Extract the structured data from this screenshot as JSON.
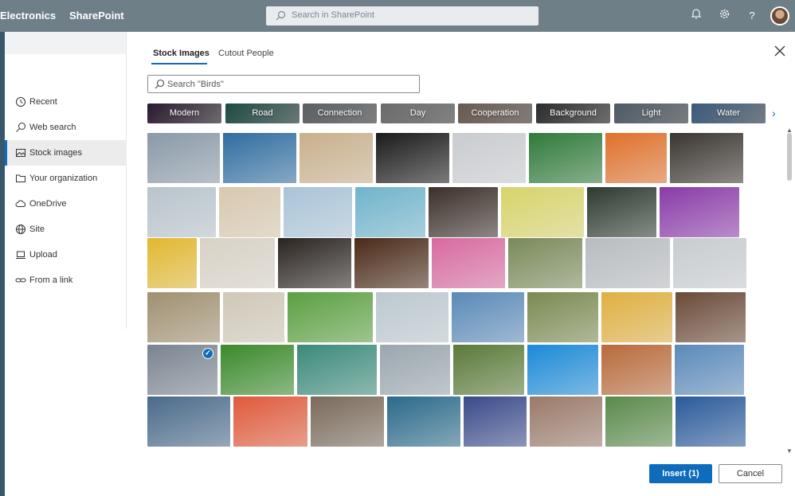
{
  "suite": {
    "brand": "Electronics",
    "app": "SharePoint",
    "search_placeholder": "Search in SharePoint"
  },
  "nav": {
    "items": [
      {
        "label": "Recent",
        "icon": "clock-icon"
      },
      {
        "label": "Web search",
        "icon": "search-icon"
      },
      {
        "label": "Stock images",
        "icon": "image-icon"
      },
      {
        "label": "Your organization",
        "icon": "folder-icon"
      },
      {
        "label": "OneDrive",
        "icon": "cloud-icon"
      },
      {
        "label": "Site",
        "icon": "globe-icon"
      },
      {
        "label": "Upload",
        "icon": "laptop-icon"
      },
      {
        "label": "From a link",
        "icon": "link-icon"
      }
    ],
    "active": "Stock images"
  },
  "tabs": [
    {
      "label": "Stock Images",
      "active": true
    },
    {
      "label": "Cutout People",
      "active": false
    }
  ],
  "search": {
    "placeholder": "Search \"Birds\""
  },
  "categories": [
    {
      "label": "Modern",
      "color": "#2a1a2e"
    },
    {
      "label": "Road",
      "color": "#1d4a44"
    },
    {
      "label": "Connection",
      "color": "#5a5f63"
    },
    {
      "label": "Day",
      "color": "#6b6b6b"
    },
    {
      "label": "Cooperation",
      "color": "#6a5a50"
    },
    {
      "label": "Background",
      "color": "#2b2b2b"
    },
    {
      "label": "Light",
      "color": "#4d5a66"
    },
    {
      "label": "Water",
      "color": "#3a5a7a"
    }
  ],
  "grid_rows": [
    [
      "#8a9aa8",
      "#2f6da0",
      "#c9b08c",
      "#1a1a1a",
      "#c9ccd0",
      "#2f7a3a",
      "#e0702a",
      "#3a3530"
    ],
    [
      "#b8c4cc",
      "#d8c8ae",
      "#a9c4d8",
      "#6fb4cc",
      "#3b2f2a",
      "#d8d46a",
      "#2d3a30",
      "#8a3aa8"
    ],
    [
      "#e2b830",
      "#d8d2c6",
      "#2a2420",
      "#4a2a18",
      "#d86aa0",
      "#7a8a5a",
      "#b8bcc0",
      "#c8ccd0"
    ],
    [
      "#a09070",
      "#d0c8b8",
      "#5aa040",
      "#bcc8d0",
      "#5a8ab8",
      "#7a8a50",
      "#e0b040",
      "#6a4a38"
    ],
    [
      "#7a8490",
      "#3a8a2a",
      "#3a8a7a",
      "#9aa6ae",
      "#5a7a38",
      "#1a8ad8",
      "#b86a3a",
      "#5a8aba"
    ],
    [
      "#4a6a8a",
      "#e05a3a",
      "#7a6a5a",
      "#2a6a8a",
      "#3a4a8a",
      "#9a7a6a",
      "#5a8a4a",
      "#2a5a9a"
    ]
  ],
  "selected_index": 32,
  "footer": {
    "insert_label": "Insert (1)",
    "cancel_label": "Cancel"
  },
  "colors": {
    "accent": "#0f6cbd",
    "suitebar": "#6f7f88"
  }
}
